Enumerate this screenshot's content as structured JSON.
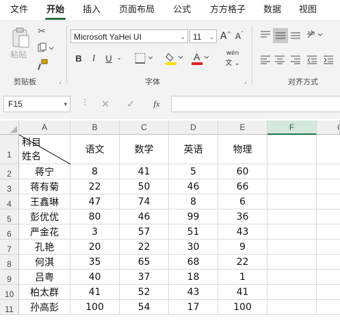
{
  "tabs": [
    "文件",
    "开始",
    "插入",
    "页面布局",
    "公式",
    "方方格子",
    "数据",
    "视图"
  ],
  "ribbon": {
    "paste_label": "粘贴",
    "clipboard_label": "剪贴板",
    "font_name": "Microsoft YaHei UI",
    "font_size": "11",
    "grow_font": "A",
    "shrink_font": "A",
    "bold": "B",
    "italic": "I",
    "underline": "U",
    "font_color_letter": "A",
    "phonetic": "wén",
    "font_label": "字体",
    "align_label": "对齐方式",
    "highlight_color": "#f7e000",
    "font_color": "#e02020"
  },
  "formula_bar": {
    "name_box": "F15",
    "fx": "fx",
    "value": ""
  },
  "columns": [
    "A",
    "B",
    "C",
    "D",
    "E",
    "F",
    "G"
  ],
  "header_cell": {
    "top": "科目",
    "bottom": "姓名"
  },
  "subjects": [
    "语文",
    "数学",
    "英语",
    "物理"
  ],
  "rows": [
    {
      "num": "2",
      "name": "蒋宁",
      "scores": [
        "8",
        "41",
        "5",
        "60"
      ]
    },
    {
      "num": "3",
      "name": "蒋有菊",
      "scores": [
        "22",
        "50",
        "46",
        "66"
      ]
    },
    {
      "num": "4",
      "name": "王鑫琳",
      "scores": [
        "47",
        "74",
        "8",
        "6"
      ]
    },
    {
      "num": "5",
      "name": "彭优优",
      "scores": [
        "80",
        "46",
        "99",
        "36"
      ]
    },
    {
      "num": "6",
      "name": "严金花",
      "scores": [
        "3",
        "57",
        "51",
        "43"
      ]
    },
    {
      "num": "7",
      "name": "孔艳",
      "scores": [
        "20",
        "22",
        "30",
        "9"
      ]
    },
    {
      "num": "8",
      "name": "何淇",
      "scores": [
        "35",
        "65",
        "68",
        "22"
      ]
    },
    {
      "num": "9",
      "name": "吕粤",
      "scores": [
        "40",
        "37",
        "18",
        "1"
      ]
    },
    {
      "num": "10",
      "name": "柏太群",
      "scores": [
        "41",
        "52",
        "43",
        "41"
      ]
    },
    {
      "num": "11",
      "name": "孙高彭",
      "scores": [
        "100",
        "54",
        "17",
        "100"
      ]
    }
  ],
  "row1_num": "1"
}
